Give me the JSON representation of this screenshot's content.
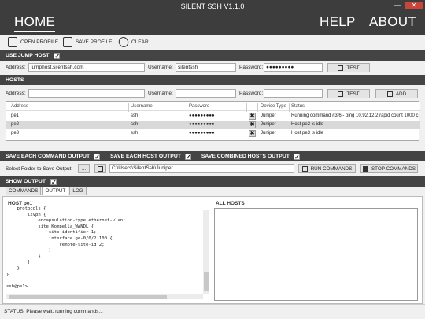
{
  "window": {
    "title": "SILENT SSH V1.1.0",
    "minimize": "—",
    "close": "✕"
  },
  "nav": {
    "home": "HOME",
    "help": "HELP",
    "about": "ABOUT"
  },
  "toolbar": {
    "open_label": "OPEN PROFILE",
    "save_label": "SAVE PROFILE",
    "clear_label": "CLEAR"
  },
  "jump_host": {
    "section_label": "USE JUMP HOST",
    "checked": true,
    "address_label": "Address:",
    "address_value": "jumphost.silentssh.com",
    "username_label": "Username:",
    "username_value": "silentssh",
    "password_label": "Password:",
    "password_value": "●●●●●●●●●",
    "test_label": "TEST"
  },
  "hosts": {
    "section_label": "HOSTS",
    "address_label": "Address:",
    "address_value": "",
    "username_label": "Username:",
    "username_value": "",
    "password_label": "Password:",
    "password_value": "",
    "test_label": "TEST",
    "add_label": "ADD",
    "columns": [
      "Address",
      "Username",
      "Password",
      "",
      "Device Type",
      "Status"
    ],
    "rows": [
      {
        "address": "pe1",
        "username": "ssh",
        "password": "●●●●●●●●●",
        "delete": "✖",
        "device_type": "Juniper",
        "status": "Running command #3/6 - ping 10.92.12.2 rapid count 1000 c"
      },
      {
        "address": "pe2",
        "username": "ssh",
        "password": "●●●●●●●●●",
        "delete": "✖",
        "device_type": "Juniper",
        "status": "Host pe2 is idle"
      },
      {
        "address": "pe3",
        "username": "ssh",
        "password": "●●●●●●●●●",
        "delete": "✖",
        "device_type": "Juniper",
        "status": "Host pe3 is idle"
      }
    ]
  },
  "save_options": {
    "each_command": "SAVE EACH COMMAND OUTPUT",
    "each_host": "SAVE EACH HOST OUTPUT",
    "combined": "SAVE COMBINED HOSTS OUTPUT",
    "folder_label": "Select Folder to Save Output:",
    "browse_label": "...",
    "folder_path": "C:\\Users\\SilentSsh\\Juniper",
    "run_label": "RUN COMMANDS",
    "stop_label": "STOP COMMANDS"
  },
  "output": {
    "section_label": "SHOW OUTPUT",
    "tabs": [
      "COMMANDS",
      "OUTPUT",
      "LOG"
    ],
    "host_header": "HOST pe1",
    "all_hosts_header": "ALL HOSTS",
    "terminal_text": "    protocols {\n        l2vpn {\n            encapsulation-type ethernet-vlan;\n            site Kompella_WANDL {\n                site-identifier 1;\n                interface ge-0/0/2.100 {\n                    remote-site-id 2;\n                }\n            }\n        }\n    }\n}\n\nssh@pe1>"
  },
  "status": {
    "text": "STATUS: Please wait, running commands..."
  },
  "colors": {
    "titlebar": "#3d3d3d",
    "section": "#444444",
    "close": "#c7453a"
  }
}
